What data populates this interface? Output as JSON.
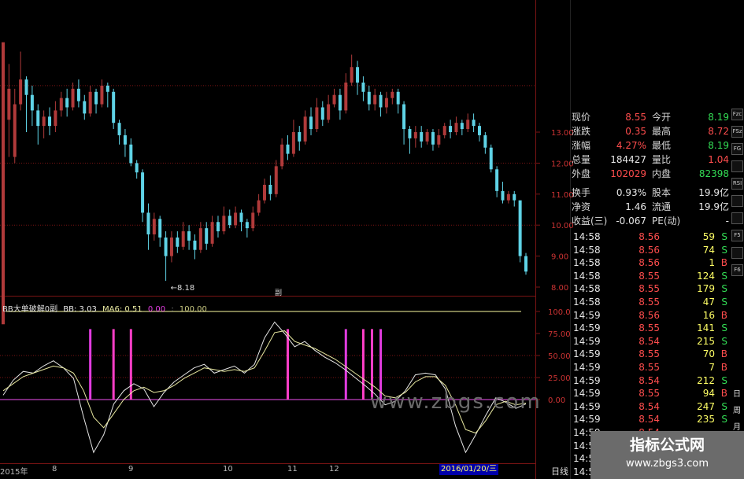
{
  "colors": {
    "up": "#b03a3a",
    "down": "#5fd3e6",
    "grid": "#7a1414",
    "ma_yellow": "#e8e8a0",
    "ma_white": "#e6e6e6",
    "bar_pink": "#ff3ec8",
    "bar_magenta": "#e23ce0",
    "zero_line": "#c040c0",
    "top_line": "#c8c880",
    "badge_bg": "#6b6b6b"
  },
  "main_chart": {
    "price_axis": [
      "13.00",
      "12.00",
      "11.00",
      "10.00",
      "9.00",
      "8.00"
    ],
    "low_marker": "8.18",
    "sub_label": "副",
    "candles": [
      [
        6.8,
        15.9,
        15.5,
        13.4
      ],
      [
        13.4,
        14.4,
        15.2,
        12.2
      ],
      [
        12.2,
        13.9,
        14.4,
        12.0
      ],
      [
        13.9,
        14.7,
        15.6,
        13.7
      ],
      [
        14.7,
        14.2,
        14.8,
        13.0
      ],
      [
        14.2,
        13.7,
        14.5,
        13.2
      ],
      [
        13.7,
        13.2,
        13.9,
        12.6
      ],
      [
        13.2,
        13.5,
        13.7,
        12.8
      ],
      [
        13.5,
        13.2,
        13.8,
        12.9
      ],
      [
        13.2,
        13.7,
        14.0,
        13.0
      ],
      [
        13.7,
        14.1,
        14.3,
        13.5
      ],
      [
        14.1,
        13.8,
        14.4,
        13.5
      ],
      [
        13.8,
        14.4,
        14.6,
        13.7
      ],
      [
        14.4,
        14.0,
        14.7,
        13.8
      ],
      [
        14.0,
        13.6,
        14.2,
        13.4
      ],
      [
        13.6,
        14.3,
        14.5,
        13.5
      ],
      [
        14.3,
        13.9,
        14.4,
        13.6
      ],
      [
        13.9,
        14.5,
        14.7,
        13.8
      ],
      [
        14.5,
        14.3,
        14.6,
        13.8
      ],
      [
        14.3,
        13.3,
        14.4,
        13.1
      ],
      [
        13.3,
        12.9,
        13.4,
        12.6
      ],
      [
        12.9,
        12.6,
        13.1,
        12.2
      ],
      [
        12.6,
        12.0,
        12.8,
        11.9
      ],
      [
        12.0,
        11.7,
        12.1,
        11.5
      ],
      [
        11.7,
        10.4,
        11.8,
        10.1
      ],
      [
        10.4,
        9.7,
        10.7,
        9.2
      ],
      [
        9.7,
        10.2,
        10.4,
        9.5
      ],
      [
        10.2,
        9.6,
        10.3,
        9.3
      ],
      [
        9.6,
        9.0,
        9.8,
        8.2
      ],
      [
        9.0,
        9.6,
        9.8,
        8.8
      ],
      [
        9.6,
        9.3,
        9.8,
        9.1
      ],
      [
        9.3,
        9.8,
        10.1,
        9.2
      ],
      [
        9.8,
        9.5,
        10.0,
        9.2
      ],
      [
        9.5,
        9.2,
        9.7,
        8.9
      ],
      [
        9.2,
        9.9,
        10.1,
        9.1
      ],
      [
        9.9,
        9.4,
        10.1,
        9.2
      ],
      [
        9.4,
        10.1,
        10.3,
        9.3
      ],
      [
        10.1,
        9.8,
        10.3,
        9.6
      ],
      [
        9.8,
        10.3,
        10.6,
        9.7
      ],
      [
        10.3,
        10.0,
        10.5,
        9.9
      ],
      [
        10.0,
        10.4,
        10.6,
        9.9
      ],
      [
        10.4,
        10.1,
        10.5,
        9.8
      ],
      [
        10.1,
        9.9,
        10.2,
        9.6
      ],
      [
        9.9,
        10.4,
        10.6,
        9.8
      ],
      [
        10.4,
        10.8,
        11.0,
        10.3
      ],
      [
        10.8,
        11.3,
        11.5,
        10.7
      ],
      [
        11.3,
        11.0,
        11.6,
        10.8
      ],
      [
        11.0,
        11.9,
        12.1,
        10.9
      ],
      [
        11.9,
        12.6,
        12.8,
        11.8
      ],
      [
        12.6,
        12.3,
        12.9,
        12.1
      ],
      [
        12.3,
        13.0,
        13.4,
        12.2
      ],
      [
        13.0,
        12.7,
        13.2,
        12.4
      ],
      [
        12.7,
        13.5,
        13.7,
        12.6
      ],
      [
        13.5,
        13.1,
        13.8,
        12.9
      ],
      [
        13.1,
        13.8,
        14.1,
        13.0
      ],
      [
        13.8,
        13.4,
        14.0,
        13.2
      ],
      [
        13.4,
        13.9,
        14.2,
        13.3
      ],
      [
        13.9,
        14.2,
        14.4,
        13.8
      ],
      [
        14.2,
        13.7,
        14.4,
        13.4
      ],
      [
        13.7,
        14.6,
        14.9,
        13.6
      ],
      [
        14.6,
        15.1,
        15.5,
        14.5
      ],
      [
        15.1,
        14.6,
        15.3,
        14.2
      ],
      [
        14.6,
        14.3,
        14.8,
        14.0
      ],
      [
        14.3,
        13.9,
        14.5,
        13.7
      ],
      [
        13.9,
        14.2,
        14.4,
        13.7
      ],
      [
        14.2,
        13.8,
        14.3,
        13.5
      ],
      [
        13.8,
        14.1,
        14.3,
        13.6
      ],
      [
        14.1,
        14.3,
        14.4,
        13.9
      ],
      [
        14.3,
        13.9,
        14.4,
        13.6
      ],
      [
        13.9,
        13.1,
        14.0,
        12.6
      ],
      [
        13.1,
        12.8,
        13.2,
        12.3
      ],
      [
        12.8,
        13.0,
        13.2,
        12.5
      ],
      [
        13.0,
        12.7,
        13.2,
        12.5
      ],
      [
        12.7,
        13.0,
        13.1,
        12.6
      ],
      [
        13.0,
        12.6,
        13.1,
        12.4
      ],
      [
        12.6,
        12.9,
        13.1,
        12.5
      ],
      [
        12.9,
        13.2,
        13.3,
        12.8
      ],
      [
        13.2,
        13.0,
        13.4,
        12.8
      ],
      [
        13.0,
        13.3,
        13.5,
        12.9
      ],
      [
        13.3,
        13.1,
        13.4,
        12.9
      ],
      [
        13.1,
        13.4,
        13.6,
        13.0
      ],
      [
        13.4,
        13.2,
        13.6,
        13.0
      ],
      [
        13.2,
        12.9,
        13.3,
        12.7
      ],
      [
        12.9,
        12.5,
        13.0,
        12.3
      ],
      [
        12.5,
        11.8,
        12.6,
        11.7
      ],
      [
        11.8,
        11.1,
        11.9,
        10.9
      ],
      [
        11.1,
        10.8,
        11.4,
        10.7
      ],
      [
        10.8,
        11.0,
        11.1,
        10.7
      ],
      [
        11.0,
        10.8,
        11.1,
        10.6
      ],
      [
        10.8,
        9.0,
        9.0,
        8.8
      ],
      [
        9.0,
        8.5,
        9.1,
        8.4
      ]
    ]
  },
  "indicator": {
    "legend": {
      "name": "BB大单破解0副",
      "bb_label": "BB: 3.03",
      "ma_label": "MA6: 0.51",
      "v1": "0.00",
      "v2": "100.00"
    },
    "axis": [
      "100.0",
      "75.00",
      "50.00",
      "25.00",
      "0.00"
    ],
    "bars": [
      15,
      19,
      22,
      49,
      59,
      62,
      63.5,
      65
    ],
    "watermark": "www.zbgs.com"
  },
  "x_axis": {
    "labels": [
      "2015年",
      "8",
      "9",
      "10",
      "11",
      "12"
    ],
    "current_date": "2016/01/20/三",
    "period": "日线"
  },
  "quote": {
    "rows": [
      {
        "l1": "现价",
        "v1": "8.55",
        "c1": "red",
        "l2": "今开",
        "v2": "8.19",
        "c2": "green"
      },
      {
        "l1": "涨跌",
        "v1": "0.35",
        "c1": "red",
        "l2": "最高",
        "v2": "8.72",
        "c2": "red"
      },
      {
        "l1": "涨幅",
        "v1": "4.27%",
        "c1": "red",
        "l2": "最低",
        "v2": "8.19",
        "c2": "green"
      },
      {
        "l1": "总量",
        "v1": "184427",
        "c1": "white",
        "l2": "量比",
        "v2": "1.04",
        "c2": "red"
      },
      {
        "l1": "外盘",
        "v1": "102029",
        "c1": "red",
        "l2": "内盘",
        "v2": "82398",
        "c2": "green"
      },
      {
        "l1": "换手",
        "v1": "0.93%",
        "c1": "white",
        "l2": "股本",
        "v2": "19.9亿",
        "c2": "white"
      },
      {
        "l1": "净资",
        "v1": "1.46",
        "c1": "white",
        "l2": "流通",
        "v2": "19.9亿",
        "c2": "white"
      },
      {
        "l1": "收益(三)",
        "v1": "-0.067",
        "c1": "white",
        "l2": "PE(动)",
        "v2": "-",
        "c2": "white"
      }
    ]
  },
  "ticks": [
    {
      "t": "14:58",
      "p": "8.56",
      "v": "59",
      "s": "S"
    },
    {
      "t": "14:58",
      "p": "8.56",
      "v": "74",
      "s": "S"
    },
    {
      "t": "14:58",
      "p": "8.56",
      "v": "1",
      "s": "B"
    },
    {
      "t": "14:58",
      "p": "8.55",
      "v": "124",
      "s": "S"
    },
    {
      "t": "14:58",
      "p": "8.55",
      "v": "179",
      "s": "S"
    },
    {
      "t": "14:58",
      "p": "8.55",
      "v": "47",
      "s": "S"
    },
    {
      "t": "14:59",
      "p": "8.56",
      "v": "16",
      "s": "B"
    },
    {
      "t": "14:59",
      "p": "8.55",
      "v": "141",
      "s": "S"
    },
    {
      "t": "14:59",
      "p": "8.54",
      "v": "215",
      "s": "S"
    },
    {
      "t": "14:59",
      "p": "8.55",
      "v": "70",
      "s": "B"
    },
    {
      "t": "14:59",
      "p": "8.55",
      "v": "7",
      "s": "B"
    },
    {
      "t": "14:59",
      "p": "8.54",
      "v": "212",
      "s": "S"
    },
    {
      "t": "14:59",
      "p": "8.55",
      "v": "94",
      "s": "B"
    },
    {
      "t": "14:59",
      "p": "8.54",
      "v": "247",
      "s": "S"
    },
    {
      "t": "14:59",
      "p": "8.54",
      "v": "235",
      "s": "S"
    },
    {
      "t": "14:59",
      "p": "8.54",
      "v": "",
      "s": ""
    },
    {
      "t": "14:59",
      "p": "",
      "v": "",
      "s": ""
    },
    {
      "t": "14:59",
      "p": "",
      "v": "",
      "s": ""
    },
    {
      "t": "14:59",
      "p": "",
      "v": "",
      "s": ""
    }
  ],
  "side_buttons": [
    "Fzc",
    "FSz",
    "FG",
    "",
    "RSI",
    "",
    "",
    "F5",
    "",
    "F6"
  ],
  "side_chars": [
    "日",
    "周",
    "月"
  ],
  "badge": {
    "title": "指标公式网",
    "url": "www.zbgs3.com"
  }
}
